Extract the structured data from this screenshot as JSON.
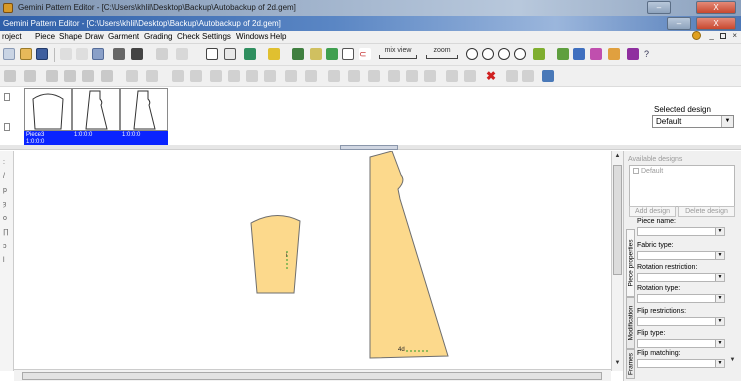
{
  "window": {
    "outer_title": "Gemini Pattern Editor - [C:\\Users\\khlil\\Desktop\\Backup\\Autobackup of 2d.gem]",
    "inner_title": "Gemini Pattern Editor - [C:\\Users\\khlil\\Desktop\\Backup\\Autobackup of 2d.gem]",
    "buttons": {
      "minimize": "–",
      "close": "X"
    }
  },
  "menubar": {
    "items": [
      "roject",
      "Piece",
      "Shape",
      "Draw",
      "Garment",
      "Grading",
      "Check",
      "Settings",
      "Windows",
      "Help"
    ],
    "right_controls": [
      "_",
      "×"
    ]
  },
  "toolbar": {
    "mix_view_label": "mix view",
    "zoom_label": "zoom"
  },
  "pieces": [
    {
      "name": "Piece3",
      "code": "1:0:0:0"
    },
    {
      "name": "",
      "code": "1:0:0:0"
    },
    {
      "name": "",
      "code": "1:0:0:0"
    }
  ],
  "design_selector": {
    "label": "Selected design",
    "value": "Default"
  },
  "canvas_annotations": {
    "sleeve_mark": "i",
    "body_mark": "4d"
  },
  "right_panel": {
    "title": "Available designs",
    "designs": [
      "Default"
    ],
    "add_design": "Add design",
    "delete_design": "Delete design",
    "tabs": [
      "Piece properties",
      "Modification",
      "Frames"
    ],
    "fields": [
      {
        "label": "Piece name:"
      },
      {
        "label": "Fabric type:"
      },
      {
        "label": "Rotation restriction:"
      },
      {
        "label": "Rotation type:"
      },
      {
        "label": "Flip restrictions:"
      },
      {
        "label": "Flip type:"
      },
      {
        "label": "Flip matching:"
      }
    ]
  },
  "colors": {
    "piece_fill": "#fcd98c",
    "piece_stroke": "#6e6e6e",
    "selection_blue": "#0a24ff"
  }
}
